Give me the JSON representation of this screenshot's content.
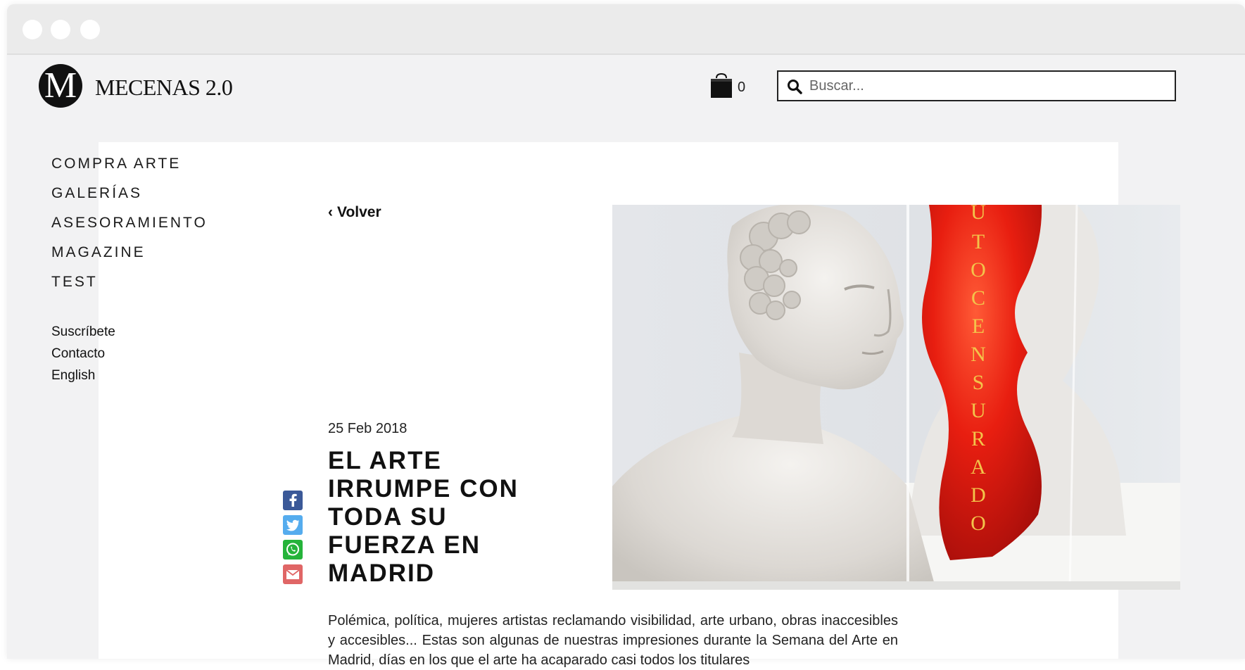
{
  "brand": {
    "logo_letter": "M",
    "name": "MECENAS 2.0"
  },
  "cart": {
    "icon": "shopping-bag-icon",
    "count": "0"
  },
  "search": {
    "placeholder": "Buscar...",
    "value": ""
  },
  "nav": {
    "items": [
      {
        "label": "COMPRA ARTE"
      },
      {
        "label": "GALERÍAS"
      },
      {
        "label": "ASESORAMIENTO"
      },
      {
        "label": "MAGAZINE"
      },
      {
        "label": "TEST"
      }
    ],
    "secondary": [
      {
        "label": "Suscríbete"
      },
      {
        "label": "Contacto"
      },
      {
        "label": "English"
      }
    ]
  },
  "article": {
    "back_label": "Volver",
    "date": "25 Feb 2018",
    "title_lines": [
      "EL ARTE",
      "IRRUMPE CON",
      "TODA SU",
      "FUERZA EN",
      "MADRID"
    ],
    "excerpt": "Polémica, política, mujeres artistas reclamando visibilidad, arte urbano, obras inaccesibles y accesibles... Estas son algunas de nuestras impresiones durante la Semana del Arte en Madrid, días en los que el arte ha acaparado casi todos los titulares",
    "image_text": "AUTOCENSURADO"
  },
  "share": [
    {
      "name": "facebook",
      "glyph": "f",
      "color": "#3b5998"
    },
    {
      "name": "twitter",
      "glyph": "t",
      "color": "#55acee"
    },
    {
      "name": "whatsapp",
      "glyph": "w",
      "color": "#25b33a"
    },
    {
      "name": "email",
      "glyph": "@",
      "color": "#e06666"
    }
  ],
  "colors": {
    "page_bg": "#f2f2f3",
    "panel_bg": "#ffffff",
    "text": "#1b1b1b",
    "accent_red": "#e81e10"
  }
}
